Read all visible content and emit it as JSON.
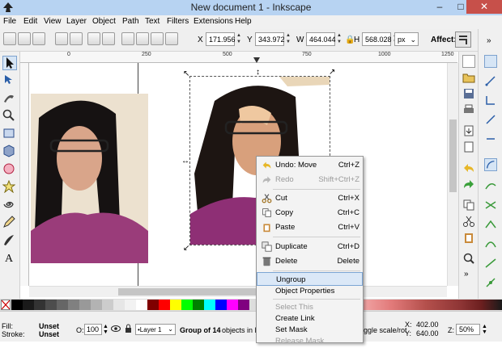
{
  "window": {
    "title": "New document 1 - Inkscape"
  },
  "menu": [
    "File",
    "Edit",
    "View",
    "Layer",
    "Object",
    "Path",
    "Text",
    "Filters",
    "Extensions",
    "Help"
  ],
  "toolbar": {
    "x_label": "X",
    "x_value": "171.956",
    "y_label": "Y",
    "y_value": "343.972",
    "w_label": "W",
    "w_value": "464.044",
    "h_label": "H",
    "h_value": "568.028",
    "unit": "px",
    "affect_label": "Affect:"
  },
  "rulers": {
    "top": [
      "0",
      "250",
      "500",
      "750",
      "1000",
      "1250"
    ]
  },
  "context_menu": {
    "items": [
      {
        "label": "Undo: Move",
        "shortcut": "Ctrl+Z",
        "icon": "undo-icon",
        "disabled": false
      },
      {
        "label": "Redo",
        "shortcut": "Shift+Ctrl+Z",
        "icon": "redo-icon",
        "disabled": true
      },
      {
        "label": "Cut",
        "shortcut": "Ctrl+X",
        "icon": "scissors-icon",
        "disabled": false
      },
      {
        "label": "Copy",
        "shortcut": "Ctrl+C",
        "icon": "copy-icon",
        "disabled": false
      },
      {
        "label": "Paste",
        "shortcut": "Ctrl+V",
        "icon": "paste-icon",
        "disabled": false
      },
      {
        "label": "Duplicate",
        "shortcut": "Ctrl+D",
        "icon": "duplicate-icon",
        "disabled": false
      },
      {
        "label": "Delete",
        "shortcut": "Delete",
        "icon": "trash-icon",
        "disabled": false
      },
      {
        "label": "Ungroup",
        "shortcut": "",
        "icon": "",
        "disabled": false
      },
      {
        "label": "Object Properties",
        "shortcut": "",
        "icon": "",
        "disabled": false
      },
      {
        "label": "Select This",
        "shortcut": "",
        "icon": "",
        "disabled": true
      },
      {
        "label": "Create Link",
        "shortcut": "",
        "icon": "",
        "disabled": false
      },
      {
        "label": "Set Mask",
        "shortcut": "",
        "icon": "",
        "disabled": false
      },
      {
        "label": "Release Mask",
        "shortcut": "",
        "icon": "",
        "disabled": true
      }
    ]
  },
  "status": {
    "fill_label": "Fill:",
    "fill_value": "Unset",
    "stroke_label": "Stroke:",
    "stroke_value": "Unset",
    "opacity_label": "O:",
    "opacity_value": "100",
    "layer": "•Layer 1",
    "message_bold": "Group of 14",
    "message_rest": "objects in lay",
    "message_tail": "ggle scale/rot",
    "cursor_x_label": "X:",
    "cursor_x": "402.00",
    "cursor_y_label": "Y:",
    "cursor_y": "640.00",
    "zoom_label": "Z:",
    "zoom": "50%"
  },
  "colors": {
    "titlebar": "#b7d3f2",
    "palette": [
      "#000000",
      "#1a1a1a",
      "#333333",
      "#4d4d4d",
      "#666666",
      "#808080",
      "#999999",
      "#b3b3b3",
      "#cccccc",
      "#e6e6e6",
      "#f2f2f2",
      "#ffffff",
      "#800000",
      "#ff0000",
      "#ffff00",
      "#00ff00",
      "#008000",
      "#00ffff",
      "#0000ff",
      "#ff00ff",
      "#800080"
    ]
  }
}
